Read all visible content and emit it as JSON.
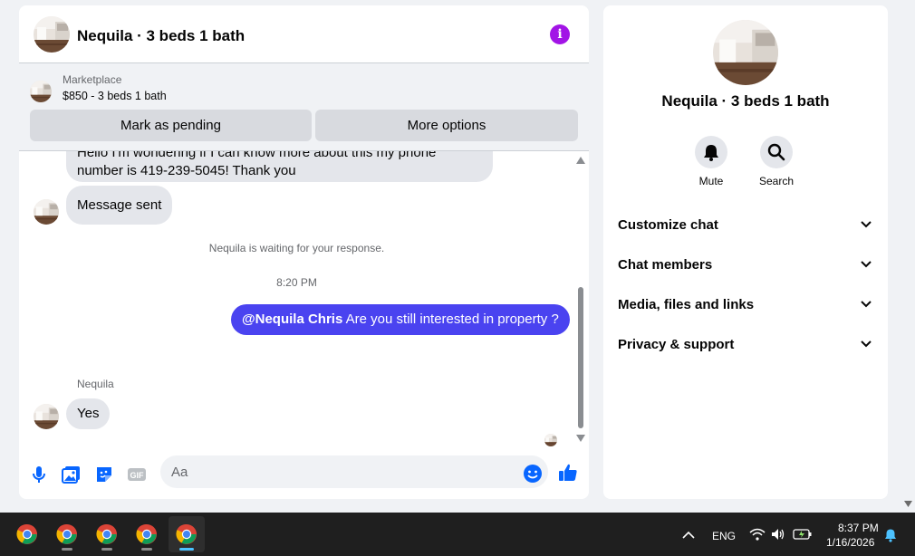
{
  "chat": {
    "title": "Nequila · 3 beds 1 bath",
    "marketplace_label": "Marketplace",
    "listing": "$850 - 3 beds 1 bath",
    "pending_button": "Mark as pending",
    "more_button": "More options",
    "messages": {
      "clipped_line1": "Hello I'm wondering if I can know more about this my phone",
      "clipped_line2": "number is 419-239-5045! Thank you",
      "sent": "Message sent",
      "waiting": "Nequila is waiting for your response.",
      "time": "8:20 PM",
      "outgoing_mention": "@Nequila Chris",
      "outgoing_text": " Are you still interested in property ?",
      "sender": "Nequila",
      "reply": "Yes"
    },
    "input_placeholder": "Aa"
  },
  "info": {
    "title": "Nequila · 3 beds 1 bath",
    "mute_label": "Mute",
    "search_label": "Search",
    "sections": [
      "Customize chat",
      "Chat members",
      "Media, files and links",
      "Privacy & support"
    ]
  },
  "taskbar": {
    "lang": "ENG",
    "time": "8:37 PM",
    "date": "1/16/2026"
  },
  "colors": {
    "accent": "#4a43f0",
    "messenger_blue": "#0866ff",
    "info_purple": "#a214e6",
    "bubble_gray": "#e4e6eb"
  },
  "icons": [
    "info-icon",
    "microphone-icon",
    "image-icon",
    "sticker-icon",
    "gif-icon",
    "emoji-icon",
    "thumbs-up-icon",
    "bell-icon",
    "search-icon",
    "chevron-down-icon",
    "chrome-icon",
    "wifi-icon",
    "volume-icon",
    "battery-icon",
    "notification-bell-icon"
  ]
}
